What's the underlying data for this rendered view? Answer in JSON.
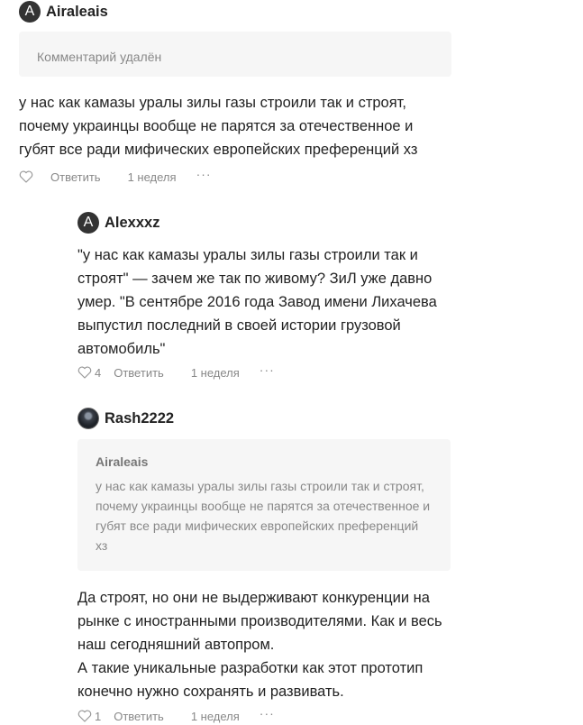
{
  "comments": [
    {
      "avatar_letter": "A",
      "author": "Airaleais",
      "deleted_notice": "Комментарий удалён",
      "text": "у нас как камазы уралы зилы газы строили так и строят, почему украинцы вообще не парятся за отечественное и губят все ради мифических европейских преференций хз",
      "likes": "",
      "reply_label": "Ответить",
      "time": "1 неделя",
      "more": "···"
    },
    {
      "avatar_letter": "A",
      "author": "Alexxxz",
      "text": "\"у нас как камазы уралы зилы газы строили так и строят\" — зачем же так по живому? ЗиЛ уже давно умер. \"В сентябре 2016 года Завод имени Лихачева выпустил последний в своей истории грузовой автомобиль\"",
      "likes": "4",
      "reply_label": "Ответить",
      "time": "1 неделя",
      "more": "···"
    },
    {
      "author": "Rash2222",
      "quote": {
        "author": "Airaleais",
        "text": "у нас как камазы уралы зилы газы строили так и строят, почему украинцы вообще не парятся за отечественное и губят все ради мифических европейских преференций хз"
      },
      "text": "Да строят, но они не выдерживают конкуренции на рынке с иностранными производителями. Как и весь наш сегодняшний автопром.\nА такие уникальные разработки как этот прототип конечно нужно сохранять и развивать.",
      "likes": "1",
      "reply_label": "Ответить",
      "time": "1 неделя",
      "more": "···"
    }
  ]
}
